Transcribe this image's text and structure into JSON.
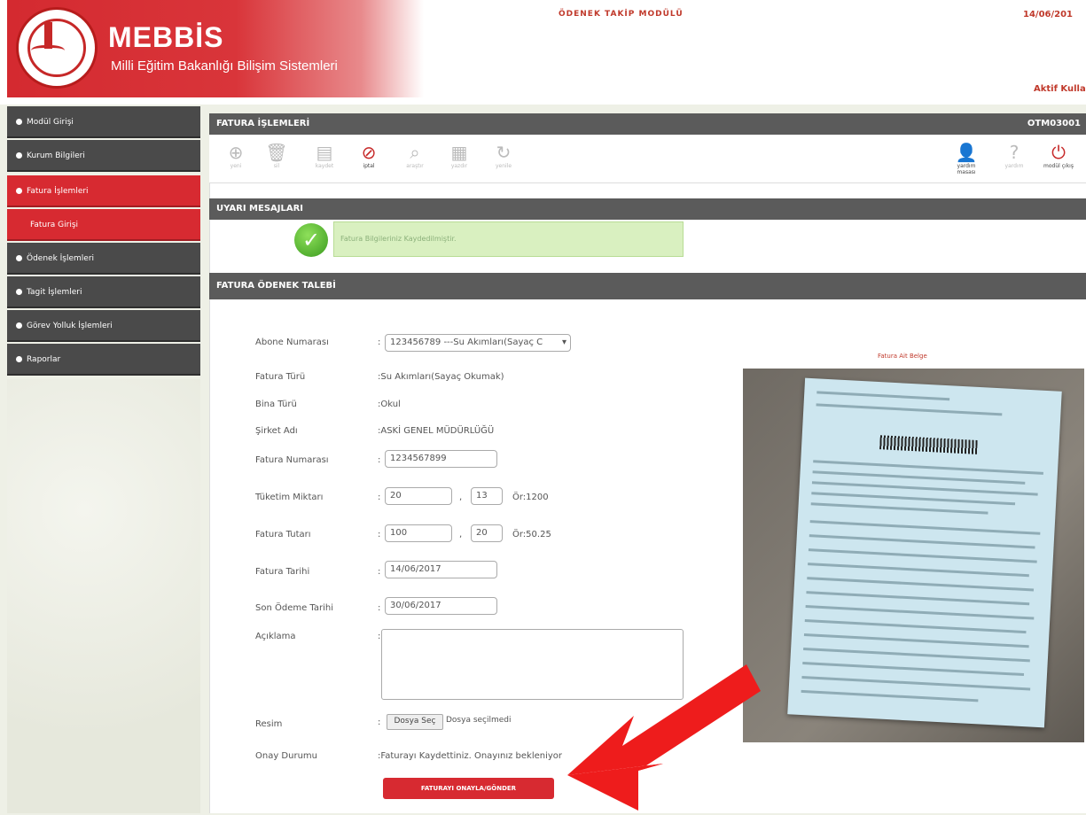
{
  "header": {
    "brand_title": "MEBBİS",
    "brand_subtitle": "Milli Eğitim Bakanlığı Bilişim Sistemleri",
    "module_title": "ÖDENEK TAKİP MODÜLÜ",
    "date": "14/06/201",
    "active_user": "Aktif Kullanıcı"
  },
  "sidebar": {
    "items": [
      {
        "label": "Modül Girişi"
      },
      {
        "label": "Kurum Bilgileri"
      },
      {
        "label": "Fatura İşlemleri"
      },
      {
        "label": "Fatura Girişi"
      },
      {
        "label": "Ödenek İşlemleri"
      },
      {
        "label": "Tagit İşlemleri"
      },
      {
        "label": "Görev Yolluk İşlemleri"
      },
      {
        "label": "Raporlar"
      }
    ]
  },
  "fatura_bar": {
    "title": "FATURA İŞLEMLERİ",
    "code": "OTM03001"
  },
  "toolbar": {
    "yeni": "yeni",
    "sil": "sil",
    "kaydet": "kaydet",
    "iptal": "iptal",
    "ara": "araştır",
    "yazdir": "yazdır",
    "yenile": "yenile",
    "yardim": "yardım masası",
    "yardim2": "yardım",
    "cikis": "modül çıkış"
  },
  "uyari": {
    "title": "UYARI MESAJLARI",
    "message": "Fatura Bilgileriniz Kaydedilmiştir."
  },
  "odenek": {
    "title": "FATURA ÖDENEK TALEBİ"
  },
  "form": {
    "abone_label": "Abone Numarası",
    "abone_value": "123456789 ---Su Akımları(Sayaç C",
    "fatura_turu_label": "Fatura Türü",
    "fatura_turu_value": ":Su Akımları(Sayaç Okumak)",
    "bina_turu_label": "Bina Türü",
    "bina_turu_value": ":Okul",
    "sirket_label": "Şirket Adı",
    "sirket_value": ":ASKİ GENEL MÜDÜRLÜĞÜ",
    "fatura_no_label": "Fatura Numarası",
    "fatura_no_value": "1234567899",
    "tuketim_label": "Tüketim Miktarı",
    "tuketim_int": "20",
    "tuketim_dec": "13",
    "tuketim_hint": "Ör:1200",
    "tutar_label": "Fatura Tutarı",
    "tutar_int": "100",
    "tutar_dec": "20",
    "tutar_hint": "Ör:50.25",
    "tarih_label": "Fatura Tarihi",
    "tarih_value": "14/06/2017",
    "son_odeme_label": "Son Ödeme Tarihi",
    "son_odeme_value": "30/06/2017",
    "aciklama_label": "Açıklama",
    "resim_label": "Resim",
    "file_button": "Dosya Seç",
    "file_status": "Dosya seçilmedi",
    "onay_label": "Onay Durumu",
    "onay_value": ":Faturayı Kaydettiniz. Onayınız bekleniyor",
    "submit": "FATURAYI ONAYLA/GÖNDER"
  },
  "photo": {
    "caption": "Fatura Ait Belge"
  },
  "colors": {
    "brand_red": "#d72a31",
    "bar_gray": "#5b5b5b",
    "success_green": "#d9f0c0"
  }
}
